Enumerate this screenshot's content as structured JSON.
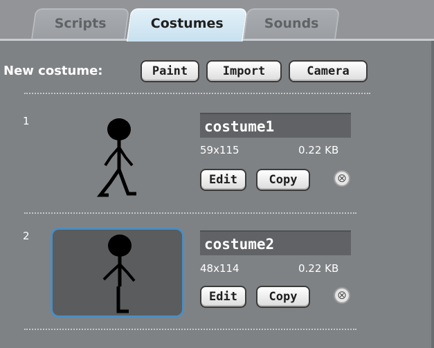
{
  "tabs": {
    "scripts": "Scripts",
    "costumes": "Costumes",
    "sounds": "Sounds"
  },
  "new_costume": {
    "label": "New costume:",
    "paint": "Paint",
    "import": "Import",
    "camera": "Camera"
  },
  "costumes": [
    {
      "index": "1",
      "name": "costume1",
      "dimensions": "59x115",
      "size": "0.22 KB",
      "edit": "Edit",
      "copy": "Copy",
      "delete": "⊗",
      "selected": false
    },
    {
      "index": "2",
      "name": "costume2",
      "dimensions": "48x114",
      "size": "0.22 KB",
      "edit": "Edit",
      "copy": "Copy",
      "delete": "⊗",
      "selected": true
    }
  ],
  "colors": {
    "panel": "#7f8285",
    "active_tab": "#c8e1ef",
    "selection": "#4a8ec4"
  }
}
